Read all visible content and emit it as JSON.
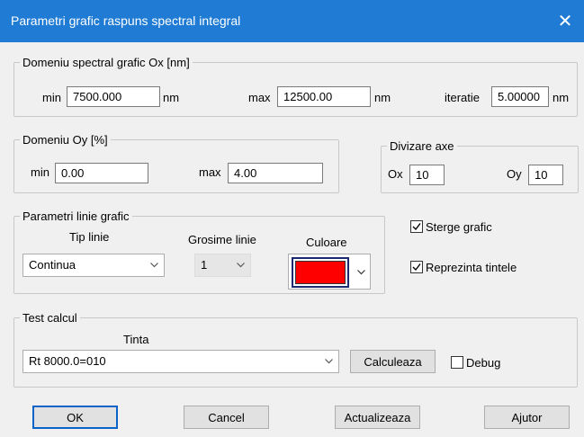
{
  "window": {
    "title": "Parametri grafic raspuns spectral integral",
    "close_glyph": "✕"
  },
  "ox_group": {
    "legend": "Domeniu spectral grafic Ox [nm]",
    "min_label": "min",
    "min_value": "7500.000",
    "max_label": "max",
    "max_value": "12500.00",
    "iter_label": "iteratie",
    "iter_value": "5.00000",
    "unit": "nm"
  },
  "oy_group": {
    "legend": "Domeniu Oy [%]",
    "min_label": "min",
    "min_value": "0.00",
    "max_label": "max",
    "max_value": "4.00"
  },
  "div_group": {
    "legend": "Divizare axe",
    "ox_label": "Ox",
    "ox_value": "10",
    "oy_label": "Oy",
    "oy_value": "10"
  },
  "line_group": {
    "legend": "Parametri linie grafic",
    "type_label": "Tip linie",
    "type_value": "Continua",
    "width_label": "Grosime linie",
    "width_value": "1",
    "color_label": "Culoare",
    "color_value": "#ff0000"
  },
  "checks": {
    "clear_label": "Sterge grafic",
    "clear_checked": true,
    "points_label": "Reprezinta tintele",
    "points_checked": true
  },
  "test_group": {
    "legend": "Test calcul",
    "tinta_label": "Tinta",
    "tinta_value": "Rt 8000.0=010",
    "calc_button": "Calculeaza",
    "debug_label": "Debug",
    "debug_checked": false
  },
  "buttons": {
    "ok": "OK",
    "cancel": "Cancel",
    "update": "Actualizeaza",
    "help": "Ajutor"
  },
  "colors": {
    "titlebar": "#1f7bd4",
    "accent": "#0a64c8"
  }
}
